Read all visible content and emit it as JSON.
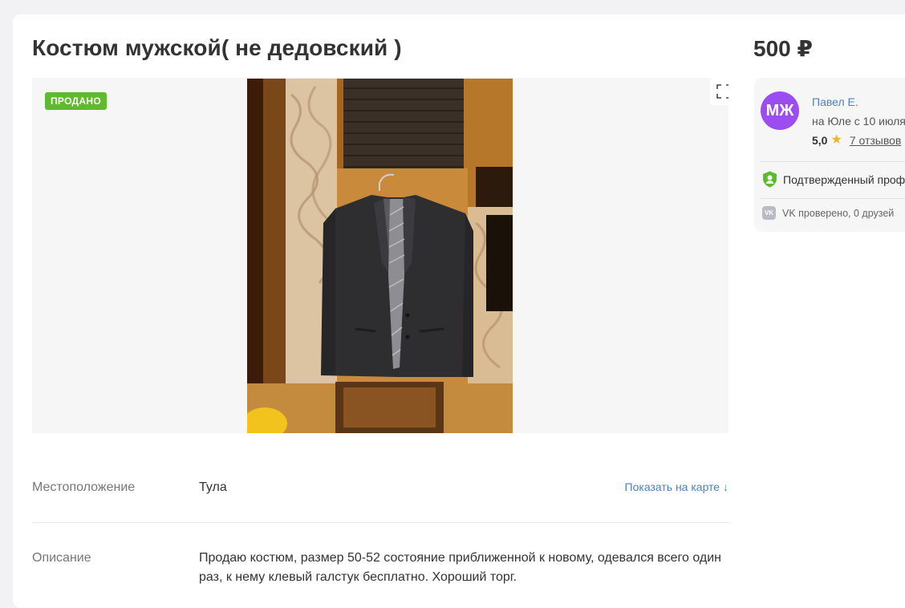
{
  "listing": {
    "title": "Костюм мужской( не дедовский )",
    "price": "500 ₽",
    "sold_badge": "ПРОДАНО",
    "photo_description": "suit-jacket-photo"
  },
  "seller": {
    "avatar_initials": "МЖ",
    "avatar_color": "#9b4df0",
    "name": "Павел Е.",
    "since": "на Юле с 10 июля",
    "rating": "5,0",
    "reviews_link": "7 отзывов",
    "verified_text": "Подтвержденный профиль",
    "vk_icon_label": "VK",
    "vk_text": "VK проверено, 0 друзей"
  },
  "details": {
    "location_label": "Местоположение",
    "location_value": "Тула",
    "map_link": "Показать на карте ↓",
    "description_label": "Описание",
    "description_value": "Продаю костюм, размер 50-52 состояние приближенной к новому, одевался всего один раз, к нему клевый галстук бесплатно. Хороший торг."
  },
  "colors": {
    "sold_badge": "#5dbb2d",
    "link": "#4a83c4",
    "star": "#f5b324",
    "verified_shield": "#5dbb2d"
  },
  "icons": {
    "expand": "expand-icon",
    "star": "star-icon",
    "verified": "shield-check-icon",
    "vk": "vk-icon"
  }
}
